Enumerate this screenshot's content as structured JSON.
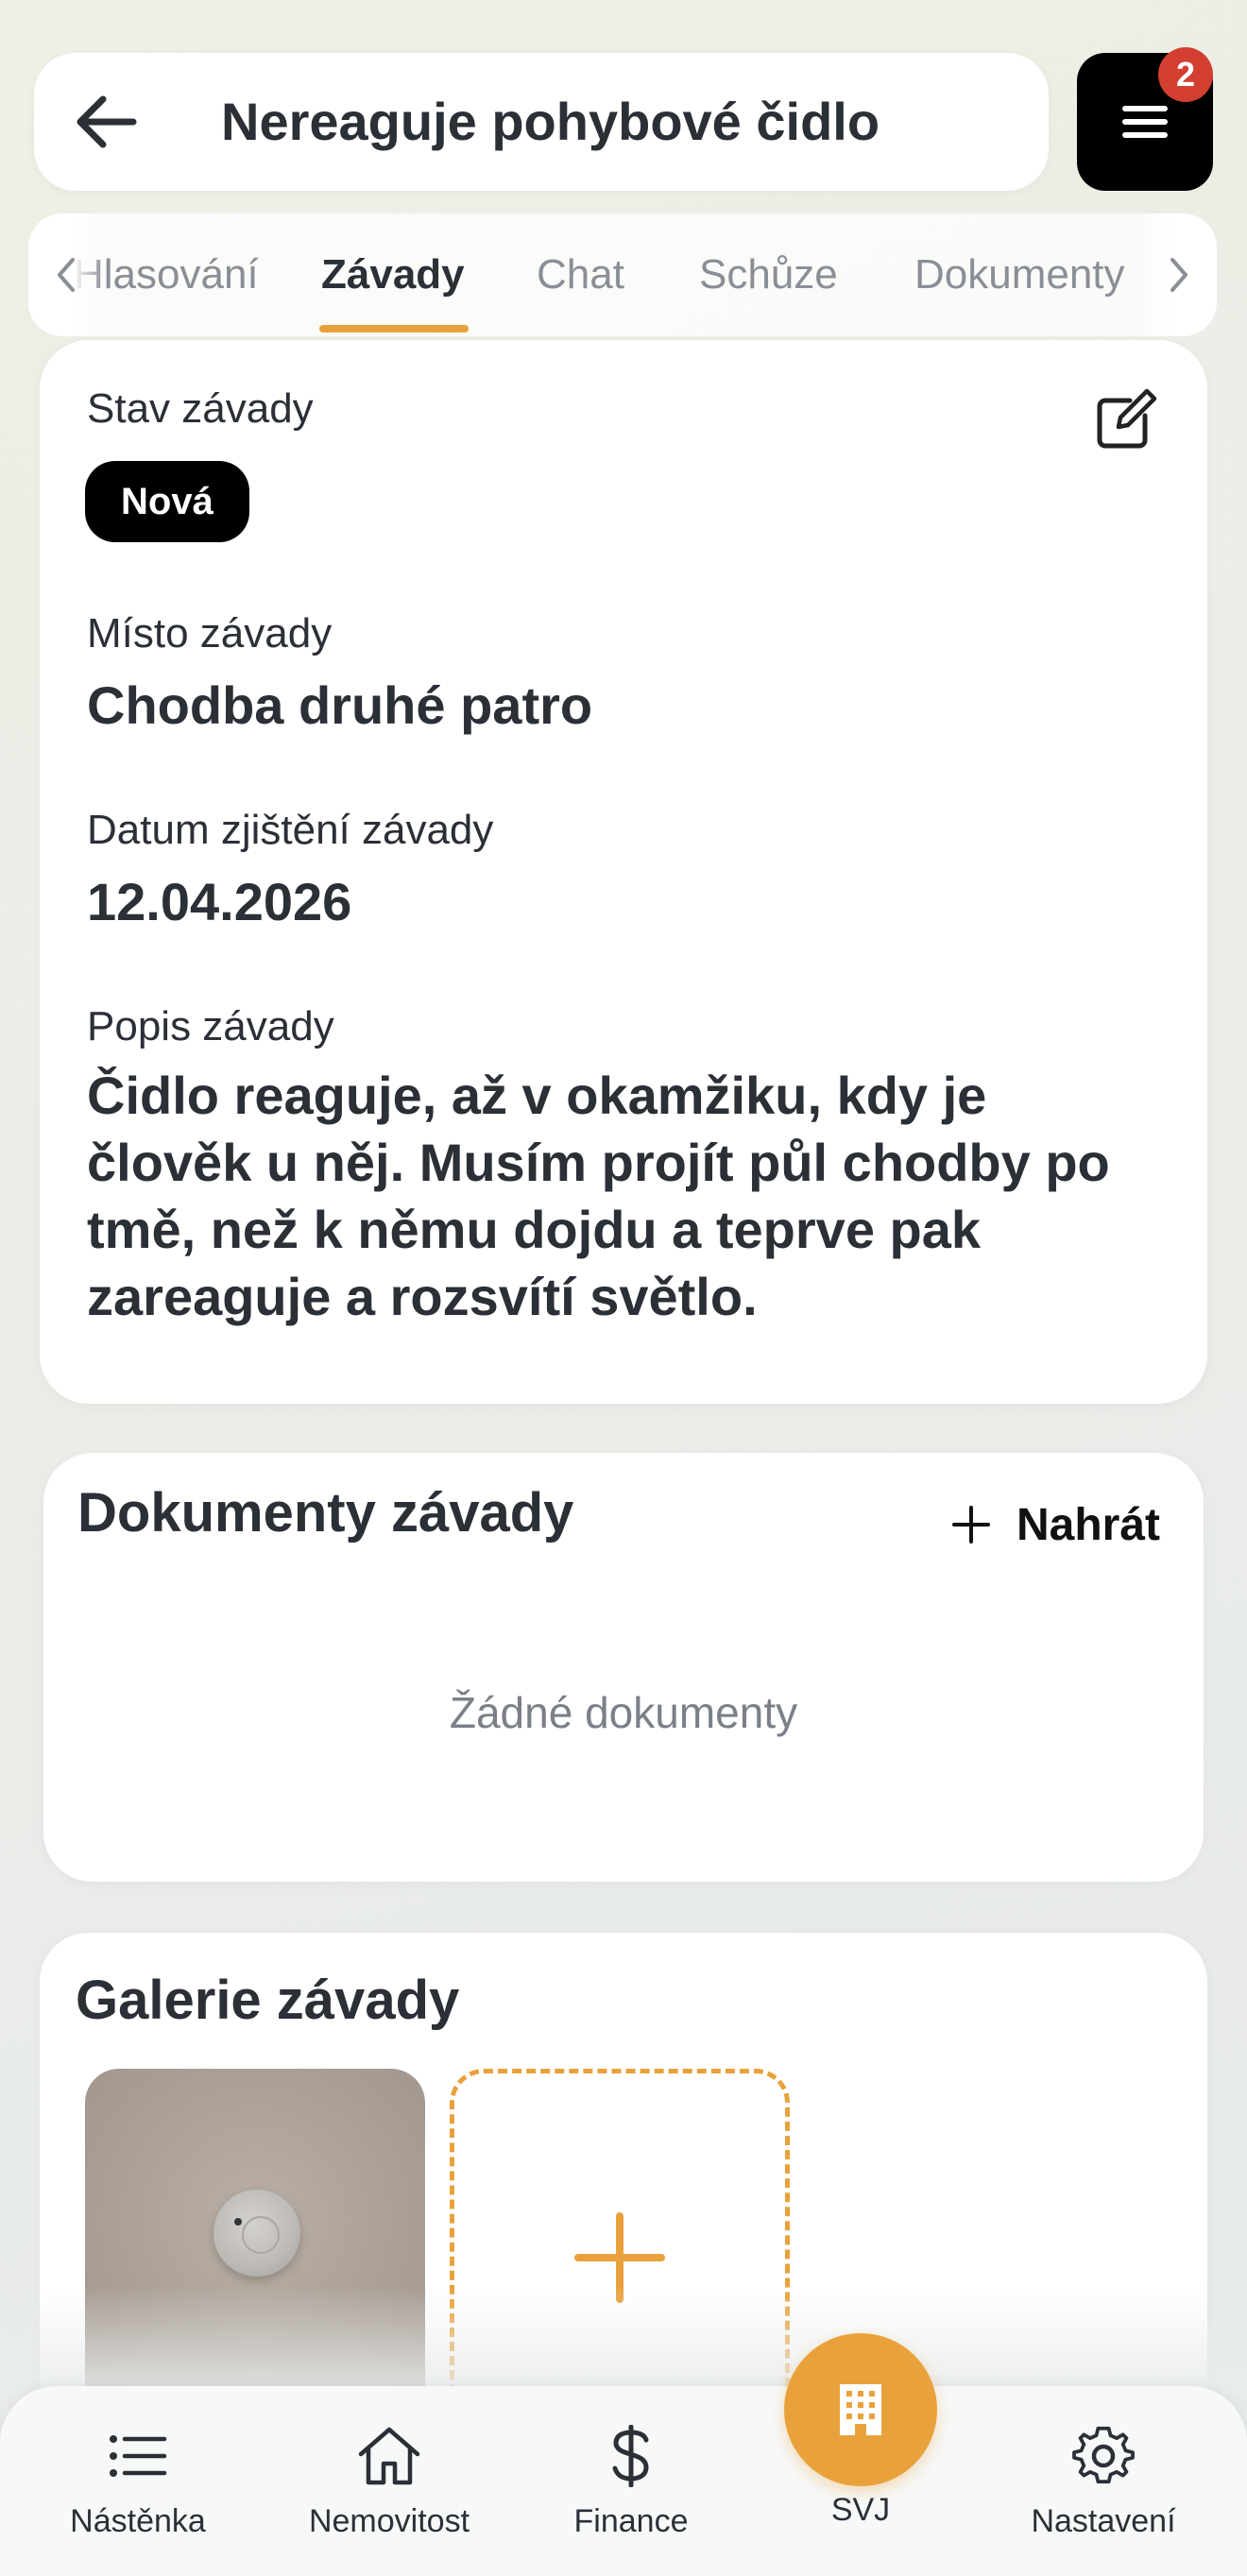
{
  "header": {
    "title": "Nereaguje pohybové čidlo",
    "back_icon": "arrow-left-icon",
    "menu_icon": "hamburger-menu-icon",
    "notification_count": "2"
  },
  "tabs": {
    "items": [
      "Hlasování",
      "Závady",
      "Chat",
      "Schůze",
      "Dokumenty"
    ],
    "active": "Závady"
  },
  "defect": {
    "status_label": "Stav závady",
    "status_value": "Nová",
    "location_label": "Místo závady",
    "location_value": "Chodba druhé patro",
    "date_label": "Datum zjištění závady",
    "date_value": "12.04.2026",
    "description_label": "Popis závady",
    "description_value": "Čidlo reaguje, až v okamžiku, kdy je člověk u něj. Musím projít půl chodby po tmě, než k němu dojdu a teprve pak zareaguje a rozsvítí světlo."
  },
  "documents": {
    "title": "Dokumenty závady",
    "upload_label": "Nahrát",
    "empty_text": "Žádné dokumenty"
  },
  "gallery": {
    "title": "Galerie závady"
  },
  "bottom_nav": {
    "items": [
      {
        "label": "Nástěnka",
        "icon": "list-icon"
      },
      {
        "label": "Nemovitost",
        "icon": "home-icon"
      },
      {
        "label": "Finance",
        "icon": "dollar-icon"
      },
      {
        "label": "SVJ",
        "icon": "building-icon"
      },
      {
        "label": "Nastavení",
        "icon": "gear-icon"
      }
    ],
    "active": "SVJ"
  },
  "colors": {
    "accent": "#e9a23b",
    "badge": "#d23f31",
    "status_badge_bg": "#000000"
  }
}
